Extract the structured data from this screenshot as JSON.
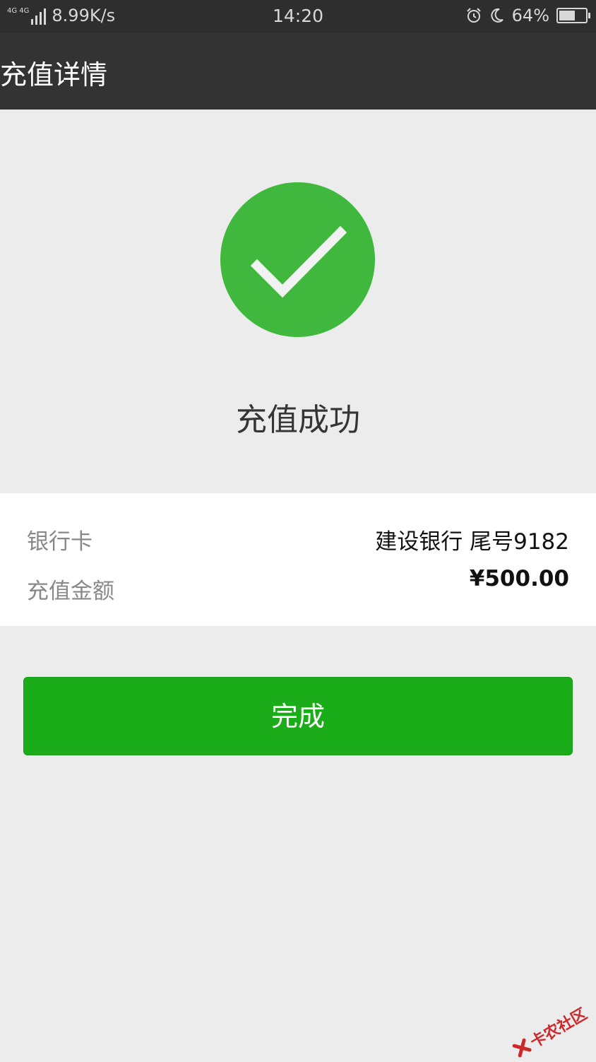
{
  "status_bar": {
    "network_label": "4G 4G",
    "speed": "8.99K/s",
    "time": "14:20",
    "battery_percent": "64%",
    "icons": [
      "signal-icon",
      "alarm-icon",
      "moon-icon",
      "battery-icon"
    ]
  },
  "header": {
    "title": "充值详情"
  },
  "result": {
    "status_text": "充值成功",
    "icon": "check-icon",
    "icon_color": "#40b83d"
  },
  "details": {
    "bank_card_label": "银行卡",
    "bank_card_value": "建设银行 尾号9182",
    "amount_label": "充值金额",
    "amount_value": "¥500.00"
  },
  "actions": {
    "done_label": "完成",
    "done_color": "#1aad19"
  },
  "watermark": {
    "text": "卡农社区"
  }
}
